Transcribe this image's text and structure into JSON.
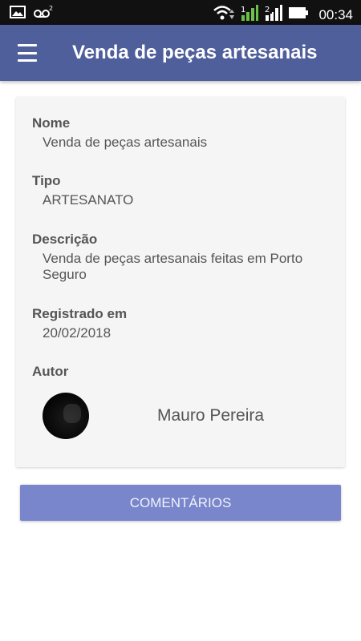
{
  "status_bar": {
    "time": "00:34",
    "icons": [
      "photo-icon",
      "voicemail-icon",
      "wifi-icon",
      "signal-icon",
      "signal-2-icon",
      "battery-icon"
    ]
  },
  "app_bar": {
    "title": "Venda de peças artesanais",
    "menu_icon": "menu-icon"
  },
  "details": {
    "name_label": "Nome",
    "name_value": "Venda de peças artesanais",
    "type_label": "Tipo",
    "type_value": "ARTESANATO",
    "description_label": "Descrição",
    "description_value": "Venda de peças artesanais feitas em Porto Seguro",
    "registered_label": "Registrado em",
    "registered_value": "20/02/2018",
    "author_label": "Autor",
    "author_name": "Mauro Pereira"
  },
  "actions": {
    "comments_label": "COMENTÁRIOS"
  },
  "colors": {
    "app_bar": "#4f5f9b",
    "button": "#7986cb",
    "text": "#555555"
  }
}
